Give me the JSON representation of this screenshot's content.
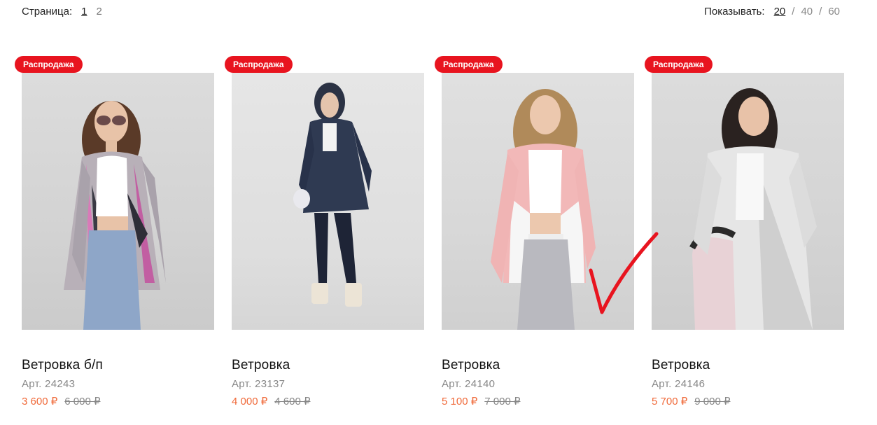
{
  "pagination": {
    "label": "Страница:",
    "pages": [
      "1",
      "2"
    ],
    "active_page": "1"
  },
  "show_count": {
    "label": "Показывать:",
    "options": [
      "20",
      "40",
      "60"
    ],
    "active": "20",
    "separator": "/"
  },
  "products": [
    {
      "badge": "Распродажа",
      "title": "Ветровка б/п",
      "sku": "Арт. 24243",
      "price_new": "3 600 ₽",
      "price_old": "6 000 ₽"
    },
    {
      "badge": "Распродажа",
      "title": "Ветровка",
      "sku": "Арт. 23137",
      "price_new": "4 000 ₽",
      "price_old": "4 600 ₽"
    },
    {
      "badge": "Распродажа",
      "title": "Ветровка",
      "sku": "Арт. 24140",
      "price_new": "5 100 ₽",
      "price_old": "7 000 ₽"
    },
    {
      "badge": "Распродажа",
      "title": "Ветровка",
      "sku": "Арт. 24146",
      "price_new": "5 700 ₽",
      "price_old": "9 000 ₽"
    }
  ],
  "colors": {
    "badge": "#e8141f",
    "price_new": "#f06a3a",
    "checkmark": "#e8141f"
  },
  "icons": {
    "annotation": "red-checkmark-icon"
  }
}
